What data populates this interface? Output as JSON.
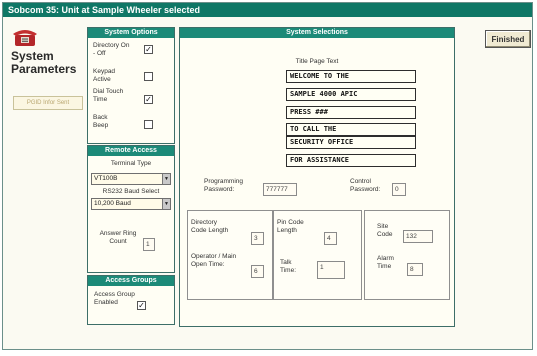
{
  "window": {
    "title": "Sobcom 35: Unit at Sample Wheeler selected"
  },
  "left": {
    "heading": "System Parameters",
    "status_text": "PGID Infor Sent"
  },
  "finished_button": "Finished",
  "system_options": {
    "header": "System Options",
    "directory_label": "Directory On - Off",
    "directory_checked": "✓",
    "keypad_label": "Keypad Active",
    "keypad_checked": "",
    "dialtouch_label": "Dial Touch Time",
    "dialtouch_checked": "✓",
    "backbeep_label": "Back Beep",
    "backbeep_checked": ""
  },
  "remote_access": {
    "header": "Remote Access",
    "terminal_type_label": "Terminal Type",
    "terminal_type_value": "VT100B",
    "baud_label": "RS232 Baud Select",
    "baud_value": "10,200 Baud",
    "answer_ring_label": "Answer Ring Count",
    "answer_ring_value": "1"
  },
  "access_groups": {
    "header": "Access Groups",
    "enabled_label": "Access Group Enabled",
    "enabled_checked": "✓"
  },
  "system_selections": {
    "header": "System Selections",
    "title_page_label": "Title Page Text",
    "title_lines": [
      "WELCOME TO THE",
      "SAMPLE 4000 APIC",
      "PRESS ###",
      "TO CALL THE",
      "SECURITY OFFICE",
      "FOR ASSISTANCE"
    ],
    "programming_password_label": "Programming Password:",
    "programming_password_value": "777777",
    "control_password_label": "Control Password:",
    "control_password_value": "0",
    "directory_code_label": "Directory Code Length",
    "directory_code_value": "3",
    "operator_label": "Operator / Main Open Time:",
    "operator_value": "6",
    "pin_code_label": "Pin Code Length",
    "pin_code_value": "4",
    "talk_time_label": "Talk Time:",
    "talk_time_value": "1",
    "site_code_label": "Site Code",
    "site_code_value": "132",
    "alarm_time_label": "Alarm Time",
    "alarm_time_value": "8"
  }
}
